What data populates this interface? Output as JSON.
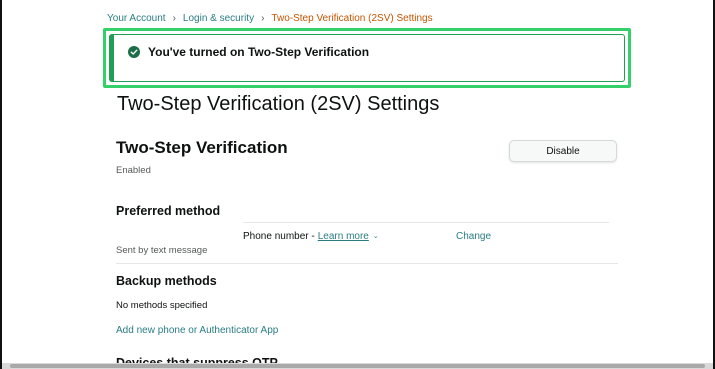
{
  "breadcrumb": {
    "items": [
      "Your Account",
      "Login & security"
    ],
    "separator": "›",
    "current": "Two-Step Verification (2SV) Settings"
  },
  "alert": {
    "message": "You've turned on Two-Step Verification",
    "icon": "check-circle-icon",
    "color": "#1f9e55"
  },
  "page": {
    "title": "Two-Step Verification (2SV) Settings"
  },
  "two_step": {
    "title": "Two-Step Verification",
    "status": "Enabled",
    "disable_label": "Disable"
  },
  "preferred": {
    "title": "Preferred method",
    "sent_by": "Sent by text message",
    "method": "Phone number -",
    "learn_more": "Learn more",
    "change_label": "Change"
  },
  "backup": {
    "title": "Backup methods",
    "none_text": "No methods specified",
    "add_link": "Add new phone or Authenticator App"
  },
  "devices": {
    "title": "Devices that suppress OTP"
  },
  "colors": {
    "link": "#2a7d83",
    "breadcrumb_current": "#c45500",
    "alert_highlight": "#34d06a"
  }
}
